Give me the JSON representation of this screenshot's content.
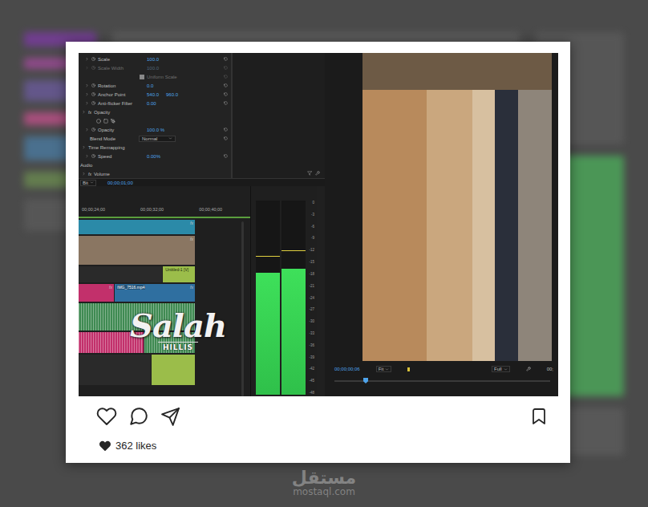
{
  "effects": [
    {
      "kind": "prop",
      "label": "Scale",
      "values": [
        "100.0"
      ],
      "disabled": false
    },
    {
      "kind": "prop",
      "label": "Scale Width",
      "values": [
        "100.0"
      ],
      "disabled": true
    },
    {
      "kind": "checkbox",
      "label": "Uniform Scale",
      "checked": true,
      "disabled": true
    },
    {
      "kind": "prop",
      "label": "Rotation",
      "values": [
        "0.0"
      ],
      "disabled": false
    },
    {
      "kind": "prop",
      "label": "Anchor Point",
      "values": [
        "540.0",
        "960.0"
      ],
      "disabled": false
    },
    {
      "kind": "prop",
      "label": "Anti-flicker Filter",
      "values": [
        "0.00"
      ],
      "disabled": false
    },
    {
      "kind": "section",
      "label": "Opacity",
      "badge": "fx"
    },
    {
      "kind": "masks"
    },
    {
      "kind": "prop",
      "label": "Opacity",
      "values": [
        "100.0 %"
      ],
      "disabled": false
    },
    {
      "kind": "select",
      "label": "Blend Mode",
      "value": "Normal"
    },
    {
      "kind": "section",
      "label": "Time Remapping",
      "badge": ""
    },
    {
      "kind": "prop",
      "label": "Speed",
      "values": [
        "0.00%"
      ],
      "disabled": false
    },
    {
      "kind": "header",
      "label": "Audio"
    },
    {
      "kind": "section",
      "label": "Volume",
      "badge": "fx"
    }
  ],
  "source_bar": {
    "dropdown": "Bit",
    "timecode": "00;00;01;00"
  },
  "timeline": {
    "ruler": [
      "00;00;24;00",
      "00;00;32;00",
      "00;00;40;00"
    ],
    "tracks": [
      {
        "clips": [
          {
            "label": "",
            "badge": "fx",
            "color": "#2b8aa8"
          }
        ]
      },
      {
        "clips": [
          {
            "label": "",
            "badge": "fx",
            "color": "#8a7662"
          }
        ]
      },
      {
        "clips": [
          {
            "label": "",
            "badge": "",
            "color": "#2a2a2a"
          },
          {
            "label": "Untitled-1 [V]",
            "badge": "",
            "color": "#9bbd4a"
          }
        ]
      },
      {
        "clips": [
          {
            "label": "",
            "badge": "fx",
            "color": "#c2306b"
          },
          {
            "label": "IMG_7516.mp4",
            "badge": "fx",
            "color": "#2f6fa0"
          }
        ]
      },
      {
        "clips": [
          {
            "label": "",
            "badge": "",
            "color": "#3f8a52"
          }
        ]
      },
      {
        "clips": [
          {
            "label": "",
            "badge": "fx",
            "color": "#c2306b"
          },
          {
            "label": "",
            "badge": "",
            "color": "#3f8a52"
          }
        ]
      },
      {
        "clips": [
          {
            "label": "",
            "badge": "",
            "color": "#2a2a2a"
          },
          {
            "label": "",
            "badge": "",
            "color": "#9bbd4a"
          }
        ]
      }
    ]
  },
  "logo": {
    "script": "Salah",
    "name": "HILLIS"
  },
  "meters": {
    "scale": [
      "0",
      "-3",
      "-6",
      "-9",
      "-12",
      "-15",
      "-18",
      "-21",
      "-24",
      "-27",
      "-30",
      "-33",
      "-36",
      "-39",
      "-42",
      "-45",
      "-48"
    ],
    "channels": [
      {
        "level": 0.63,
        "peak": 0.71
      },
      {
        "level": 0.65,
        "peak": 0.74
      }
    ]
  },
  "monitor": {
    "timecode": "00;00;00;06",
    "fit": "Fit",
    "quality": "Full",
    "end_timecode": "00;"
  },
  "post": {
    "liked": false,
    "saved": false,
    "likes": "362 likes"
  },
  "watermark": {
    "arabic": "مستقل",
    "site": "mostaql.com"
  }
}
